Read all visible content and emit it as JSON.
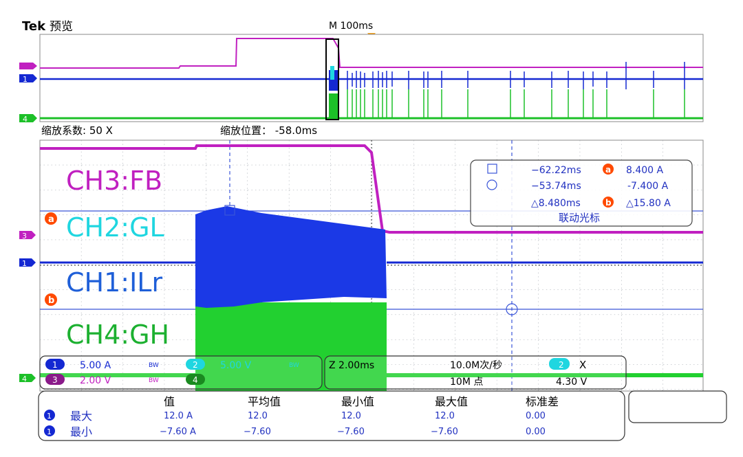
{
  "header": {
    "brand": "Tek",
    "mode": "预览",
    "timebase": "M 100ms"
  },
  "zoom": {
    "factor_label": "缩放系数: 50 X",
    "position_label": "缩放位置： -58.0ms"
  },
  "channels": {
    "ch1": {
      "marker": "1",
      "label": "CH1:ILr",
      "color": "#1428d2",
      "scale": "5.00 A",
      "bw": "BW"
    },
    "ch2": {
      "marker": "2",
      "label": "CH2:GL",
      "color": "#1fd6e0",
      "scale": "5.00 V",
      "bw": "BW"
    },
    "ch3": {
      "marker": "3",
      "label": "CH3:FB",
      "color": "#c020c0",
      "scale": "2.00 V",
      "bw": "BW"
    },
    "ch4": {
      "marker": "4",
      "label": "CH4:GH",
      "color": "#1cc028",
      "scale": "",
      "bw": ""
    }
  },
  "cursors": {
    "cursor_a_marker": "a",
    "cursor_b_marker": "b",
    "row1": {
      "time": "−62.22ms",
      "value": "8.400 A"
    },
    "row2": {
      "time": "−53.74ms",
      "value": "-7.400 A"
    },
    "row3": {
      "time": "△8.480ms",
      "value": "△15.80 A"
    },
    "linked_label": "联动光标"
  },
  "acquisition": {
    "horizontal_scale": "Z 2.00ms",
    "sample_rate": "10.0M次/秒",
    "record_length": "10M 点",
    "trigger_channel": "2",
    "trigger_symbol": "X",
    "trigger_level": "4.30 V"
  },
  "measurements": {
    "headers": [
      "值",
      "平均值",
      "最小值",
      "最大值",
      "标准差"
    ],
    "rows": [
      {
        "channel": "1",
        "label": "最大",
        "values": [
          "12.0 A",
          "12.0",
          "12.0",
          "12.0",
          "0.00"
        ]
      },
      {
        "channel": "1",
        "label": "最小",
        "values": [
          "−7.60 A",
          "−7.60",
          "−7.60",
          "−7.60",
          "0.00"
        ]
      }
    ]
  },
  "colors": {
    "grid": "#9aa0a8",
    "ref_line": "#3a55d8",
    "cursor_badge": "#ff4a00",
    "panel_border": "#555555"
  }
}
